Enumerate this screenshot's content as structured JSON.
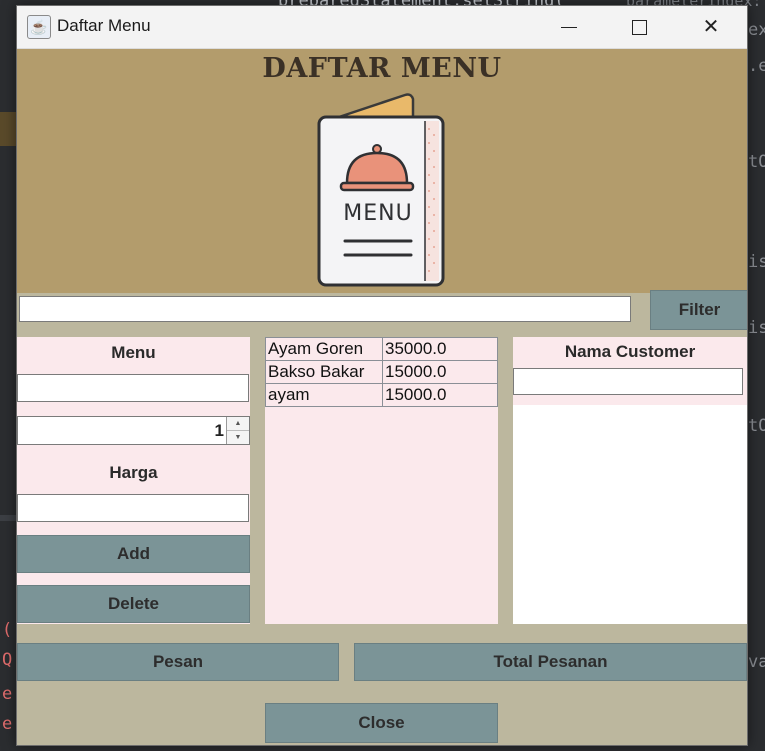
{
  "background": {
    "code_fragment": "preparedStatement.setString(",
    "hint_fragment": "parameterIndex:",
    "side_fragments": [
      "ex:",
      ".e",
      "tO",
      "is",
      "is",
      "tO",
      "va"
    ],
    "left_fragments": [
      "(",
      "Q",
      "e",
      "e"
    ]
  },
  "window": {
    "title": "Daftar Menu",
    "app_icon": "java-coffee-icon",
    "controls": {
      "minimize": "minimize-icon",
      "maximize": "maximize-icon",
      "close": "✕"
    }
  },
  "header": {
    "title": "DAFTAR MENU",
    "illustration_text": "MENU"
  },
  "search": {
    "value": "",
    "filter_label": "Filter"
  },
  "form": {
    "menu_label": "Menu",
    "menu_value": "",
    "quantity": "1",
    "harga_label": "Harga",
    "harga_value": "",
    "add_label": "Add",
    "delete_label": "Delete"
  },
  "menu_table": {
    "rows": [
      {
        "name": "Ayam Goren",
        "price": "35000.0"
      },
      {
        "name": "Bakso Bakar",
        "price": "15000.0"
      },
      {
        "name": "ayam",
        "price": "15000.0"
      }
    ]
  },
  "customer": {
    "label": "Nama Customer",
    "value": ""
  },
  "buttons": {
    "pesan": "Pesan",
    "total": "Total Pesanan",
    "close": "Close"
  },
  "colors": {
    "header_bg": "#b39c6c",
    "window_bg": "#bcb79e",
    "panel_bg": "#fbe9ec",
    "button_bg": "#7b9497"
  }
}
